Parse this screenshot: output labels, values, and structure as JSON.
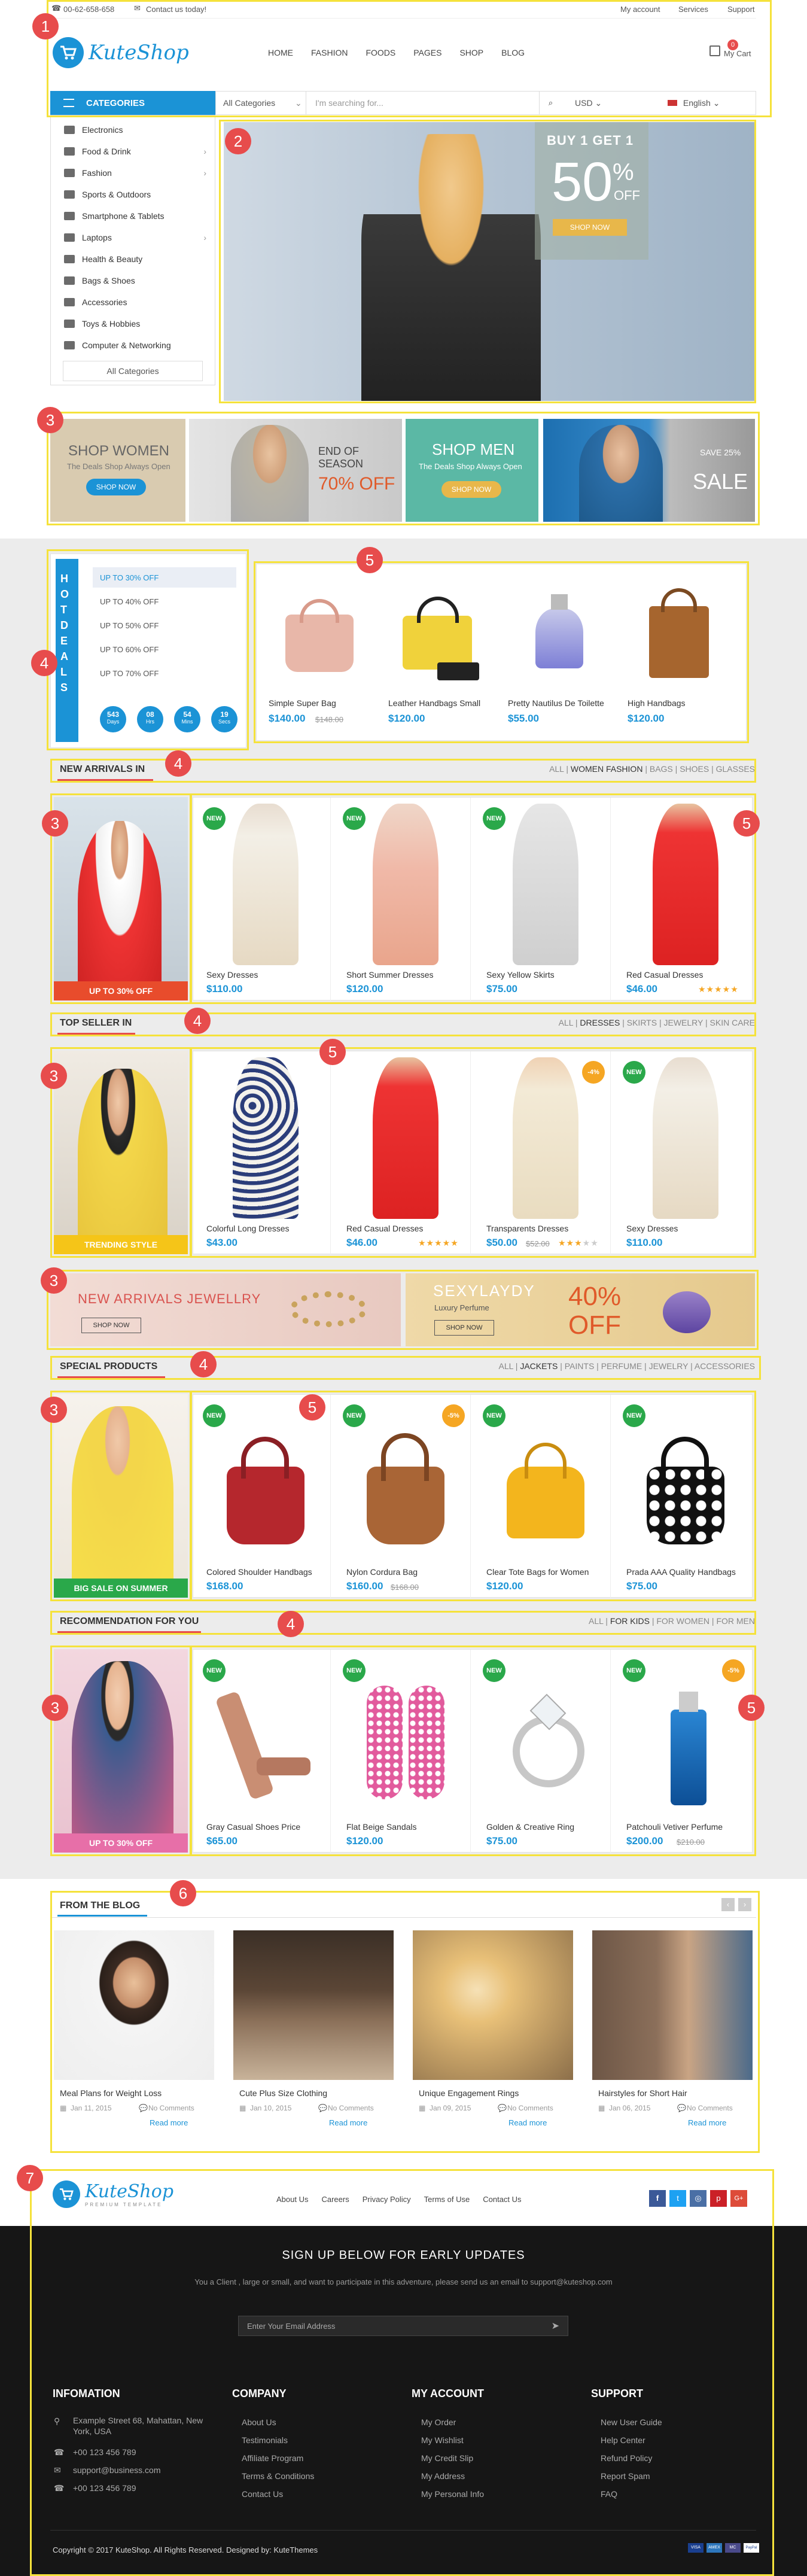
{
  "topbar": {
    "phone": "00-62-658-658",
    "contact": "Contact us today!",
    "links": [
      "My account",
      "Services",
      "Support"
    ]
  },
  "header": {
    "brand": "KuteShop",
    "nav": [
      "HOME",
      "FASHION",
      "FOODS",
      "PAGES",
      "SHOP",
      "BLOG"
    ],
    "cart_label": "My Cart",
    "cart_count": "0"
  },
  "categories_bar": {
    "title": "CATEGORIES",
    "search_category": "All Categories",
    "search_placeholder": "I'm searching for...",
    "currency": "USD",
    "language": "English"
  },
  "sidebar": {
    "items": [
      "Electronics",
      "Food & Drink",
      "Fashion",
      "Sports & Outdoors",
      "Smartphone & Tablets",
      "Laptops",
      "Health & Beauty",
      "Bags & Shoes",
      "Accessories",
      "Toys & Hobbies",
      "Computer & Networking"
    ],
    "all_label": "All Categories"
  },
  "hero": {
    "title": "BUY 1 GET 1",
    "percent": "50",
    "unit": "%",
    "off": "OFF",
    "button": "SHOP NOW"
  },
  "promos": {
    "women_title": "SHOP WOMEN",
    "women_sub": "The Deals Shop Always Open",
    "women_btn": "SHOP NOW",
    "season_title": "END OF SEASON",
    "season_off": "70% OFF",
    "men_title": "SHOP MEN",
    "men_sub": "The Deals Shop Always Open",
    "men_btn": "SHOP NOW",
    "sale_badge": "SAVE 25%",
    "sale_word": "SALE"
  },
  "hot_deals": {
    "title": "HOT DEALS",
    "options": [
      "UP TO 30% OFF",
      "UP TO 40% OFF",
      "UP TO 50% OFF",
      "UP TO 60% OFF",
      "UP TO 70% OFF"
    ],
    "countdown": [
      {
        "value": "543",
        "unit": "Days"
      },
      {
        "value": "08",
        "unit": "Hrs"
      },
      {
        "value": "54",
        "unit": "Mins"
      },
      {
        "value": "19",
        "unit": "Secs"
      }
    ],
    "products": [
      {
        "name": "Simple Super Bag",
        "price": "$140.00",
        "old": "$148.00"
      },
      {
        "name": "Leather Handbags Small",
        "price": "$120.00",
        "old": ""
      },
      {
        "name": "Pretty Nautilus De Toilette",
        "price": "$55.00",
        "old": ""
      },
      {
        "name": "High Handbags",
        "price": "$120.00",
        "old": ""
      }
    ]
  },
  "new_arrivals": {
    "title": "NEW ARRIVALS IN",
    "tabs": [
      "ALL",
      "WOMEN FASHION",
      "BAGS",
      "SHOES",
      "GLASSES"
    ],
    "banner_text": "UP TO 30% OFF",
    "products": [
      {
        "name": "Sexy Dresses",
        "price": "$110.00",
        "badge": "NEW"
      },
      {
        "name": "Short Summer Dresses",
        "price": "$120.00",
        "badge": "NEW"
      },
      {
        "name": "Sexy Yellow Skirts",
        "price": "$75.00",
        "badge": "NEW"
      },
      {
        "name": "Red Casual Dresses",
        "price": "$46.00",
        "badge": ""
      }
    ]
  },
  "top_seller": {
    "title": "TOP SELLER IN",
    "tabs": [
      "ALL",
      "DRESSES",
      "SKIRTS",
      "JEWELRY",
      "SKIN CARE"
    ],
    "banner_text": "TRENDING STYLE",
    "products": [
      {
        "name": "Colorful Long Dresses",
        "price": "$43.00",
        "old": "",
        "badge": ""
      },
      {
        "name": "Red Casual Dresses",
        "price": "$46.00",
        "old": "",
        "badge": ""
      },
      {
        "name": "Transparents Dresses",
        "price": "$50.00",
        "old": "$52.00",
        "badge": "-4%"
      },
      {
        "name": "Sexy Dresses",
        "price": "$110.00",
        "old": "",
        "badge": "NEW"
      }
    ]
  },
  "mid_banners": {
    "left_title": "NEW ARRIVALS JEWELLRY",
    "left_btn": "SHOP NOW",
    "right_brand": "SEXYLAYDY",
    "right_sub": "Luxury Perfume",
    "right_btn": "SHOP NOW",
    "right_percent": "40%",
    "right_off": "OFF"
  },
  "special": {
    "title": "SPECIAL PRODUCTS",
    "tabs": [
      "ALL",
      "JACKETS",
      "PAINTS",
      "PERFUME",
      "JEWELRY",
      "ACCESSORIES"
    ],
    "banner_text": "BIG SALE ON SUMMER",
    "products": [
      {
        "name": "Colored Shoulder Handbags",
        "price": "$168.00",
        "old": "",
        "badge": "NEW"
      },
      {
        "name": "Nylon Cordura Bag",
        "price": "$160.00",
        "old": "$168.00",
        "badge": "NEW"
      },
      {
        "name": "Clear Tote Bags for Women",
        "price": "$120.00",
        "old": "",
        "badge": "NEW"
      },
      {
        "name": "Prada AAA Quality Handbags",
        "price": "$75.00",
        "old": "",
        "badge": "NEW"
      }
    ],
    "badge2": "-5%"
  },
  "recommendation": {
    "title": "RECOMMENDATION FOR YOU",
    "tabs": [
      "ALL",
      "FOR KIDS",
      "FOR WOMEN",
      "FOR MEN"
    ],
    "banner_text": "UP TO 30% OFF",
    "products": [
      {
        "name": "Gray Casual Shoes Price",
        "price": "$65.00",
        "old": "",
        "badge": "NEW"
      },
      {
        "name": "Flat Beige Sandals",
        "price": "$120.00",
        "old": "",
        "badge": "NEW"
      },
      {
        "name": "Golden & Creative Ring",
        "price": "$75.00",
        "old": "",
        "badge": "NEW"
      },
      {
        "name": "Patchouli Vetiver Perfume",
        "price": "$200.00",
        "old": "$210.00",
        "badge": "NEW"
      }
    ],
    "badge_sale": "-5%"
  },
  "blog": {
    "title": "FROM THE BLOG",
    "posts": [
      {
        "title": "Meal Plans for Weight Loss",
        "date": "Jan 11, 2015",
        "comments": "No Comments",
        "more": "Read more"
      },
      {
        "title": "Cute Plus Size Clothing",
        "date": "Jan 10, 2015",
        "comments": "No Comments",
        "more": "Read more"
      },
      {
        "title": "Unique Engagement Rings",
        "date": "Jan 09, 2015",
        "comments": "No Comments",
        "more": "Read more"
      },
      {
        "title": "Hairstyles for Short Hair",
        "date": "Jan 06, 2015",
        "comments": "No Comments",
        "more": "Read more"
      }
    ]
  },
  "footer": {
    "brand": "KuteShop",
    "brand_sub": "PREMIUM TEMPLATE",
    "links": [
      "About Us",
      "Careers",
      "Privacy Policy",
      "Terms of Use",
      "Contact Us"
    ],
    "signup_title": "SIGN UP BELOW FOR EARLY UPDATES",
    "signup_text": "You a Client , large or small, and want to participate in this adventure, please send us an email to support@kuteshop.com",
    "email_placeholder": "Enter Your Email Address",
    "info_title": "INFOMATION",
    "address": "Example Street 68, Mahattan, New York, USA",
    "phone1": "+00 123 456 789",
    "email": "support@business.com",
    "phone2": "+00 123 456 789",
    "company_title": "COMPANY",
    "company": [
      "About Us",
      "Testimonials",
      "Affiliate Program",
      "Terms & Conditions",
      "Contact Us"
    ],
    "account_title": "MY ACCOUNT",
    "account": [
      "My Order",
      "My Wishlist",
      "My Credit Slip",
      "My Address",
      "My Personal Info"
    ],
    "support_title": "SUPPORT",
    "support": [
      "New User Guide",
      "Help Center",
      "Refund Policy",
      "Report Spam",
      "FAQ"
    ],
    "copyright": "Copyright © 2017 KuteShop. All Rights Reserved. Designed by: KuteThemes",
    "payments": [
      "VISA",
      "AMEX",
      "MC",
      "PayPal"
    ]
  },
  "markers": [
    "1",
    "2",
    "3",
    "4",
    "5",
    "4",
    "3",
    "5",
    "4",
    "3",
    "5",
    "3",
    "4",
    "3",
    "5",
    "4",
    "3",
    "5",
    "6",
    "7"
  ],
  "colors": {
    "accent": "#1b93d6",
    "highlight": "#f5e23b",
    "marker": "#e74c4c",
    "new_badge": "#2aa84a",
    "sale_badge": "#f5a623"
  }
}
